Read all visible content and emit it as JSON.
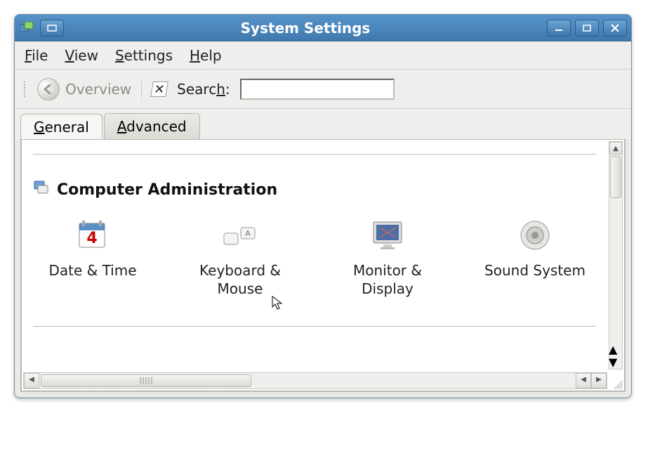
{
  "window": {
    "title": "System Settings"
  },
  "menubar": {
    "file": "File",
    "view": "View",
    "settings": "Settings",
    "help": "Help"
  },
  "toolbar": {
    "overview_label": "Overview",
    "search_label": "Search:",
    "search_value": ""
  },
  "tabs": {
    "general": "General",
    "advanced": "Advanced",
    "active": "general"
  },
  "section": {
    "title": "Computer Administration"
  },
  "items": {
    "date_time": "Date & Time",
    "keyboard_mouse": "Keyboard & Mouse",
    "monitor_display": "Monitor & Display",
    "sound_system": "Sound System"
  },
  "icons": {
    "app": "system-settings-icon",
    "back": "back-icon",
    "clear": "clear-icon",
    "section": "computer-icon",
    "date_time": "calendar-icon",
    "keyboard_mouse": "keyboard-icon",
    "monitor_display": "monitor-icon",
    "sound_system": "speaker-icon"
  }
}
